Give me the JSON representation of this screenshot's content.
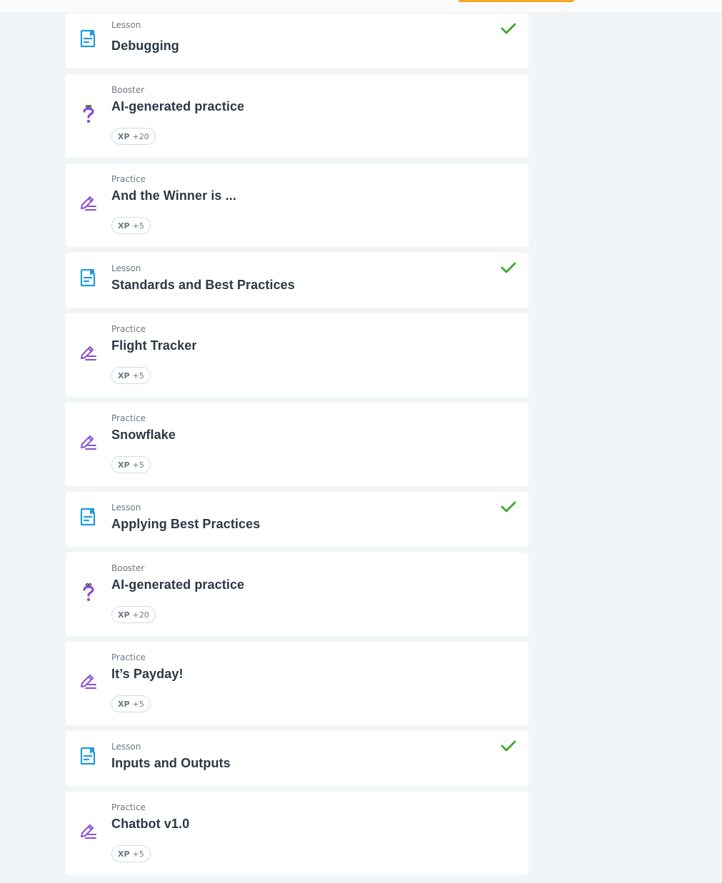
{
  "accent_colors": {
    "lesson_icon": "#1e9be0",
    "practice_icon": "#8a4fd8",
    "check": "#3fa528",
    "top_accent": "#f6a723"
  },
  "items": [
    {
      "type": "Lesson",
      "title": "Debugging",
      "completed": true,
      "icon": "lesson-icon"
    },
    {
      "type": "Booster",
      "title": "AI-generated practice",
      "xp_label": "XP",
      "xp_value": "+20",
      "icon": "booster-question-icon"
    },
    {
      "type": "Practice",
      "title": "And the Winner is ...",
      "xp_label": "XP",
      "xp_value": "+5",
      "icon": "practice-pencil-icon"
    },
    {
      "type": "Lesson",
      "title": "Standards and Best Practices",
      "completed": true,
      "icon": "lesson-icon"
    },
    {
      "type": "Practice",
      "title": "Flight Tracker",
      "xp_label": "XP",
      "xp_value": "+5",
      "icon": "practice-pencil-icon"
    },
    {
      "type": "Practice",
      "title": "Snowflake",
      "xp_label": "XP",
      "xp_value": "+5",
      "icon": "practice-pencil-icon"
    },
    {
      "type": "Lesson",
      "title": "Applying Best Practices",
      "completed": true,
      "icon": "lesson-icon"
    },
    {
      "type": "Booster",
      "title": "AI-generated practice",
      "xp_label": "XP",
      "xp_value": "+20",
      "icon": "booster-question-icon"
    },
    {
      "type": "Practice",
      "title": "It’s Payday!",
      "xp_label": "XP",
      "xp_value": "+5",
      "icon": "practice-pencil-icon"
    },
    {
      "type": "Lesson",
      "title": "Inputs and Outputs",
      "completed": true,
      "icon": "lesson-icon"
    },
    {
      "type": "Practice",
      "title": "Chatbot v1.0",
      "xp_label": "XP",
      "xp_value": "+5",
      "icon": "practice-pencil-icon"
    }
  ]
}
